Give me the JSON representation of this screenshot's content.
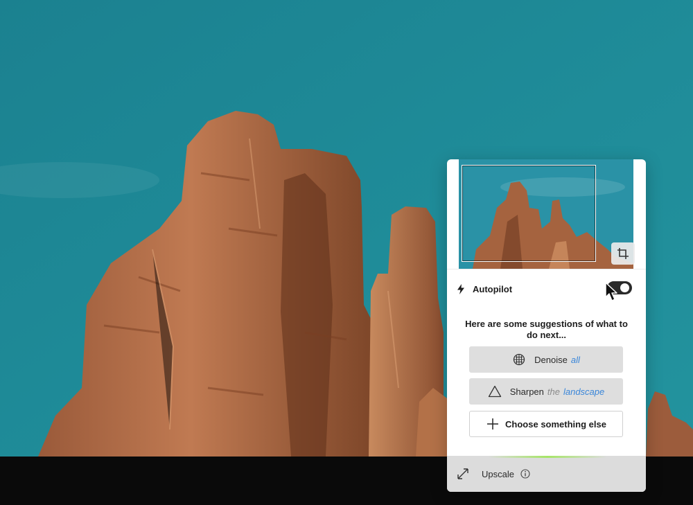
{
  "panel": {
    "autopilot_label": "Autopilot",
    "autopilot_enabled": true,
    "suggestion_text": "Here are some suggestions of what to do next...",
    "suggestions": [
      {
        "icon": "grid-globe-icon",
        "action": "Denoise",
        "connector": "",
        "target": "all"
      },
      {
        "icon": "triangle-icon",
        "action": "Sharpen",
        "connector": "the",
        "target": "landscape"
      },
      {
        "icon": "plus-icon",
        "action": "Choose something else"
      }
    ],
    "upscale_label": "Upscale"
  },
  "colors": {
    "sky": "#1f8a98",
    "rock": "#b06c48",
    "panel_bg": "#ffffff",
    "button_bg": "#dedede",
    "accent": "#3a86d9",
    "toggle": "#2a2a2a"
  },
  "icons": [
    "crop-icon",
    "bolt-icon",
    "cursor-icon",
    "expand-icon",
    "info-icon"
  ]
}
